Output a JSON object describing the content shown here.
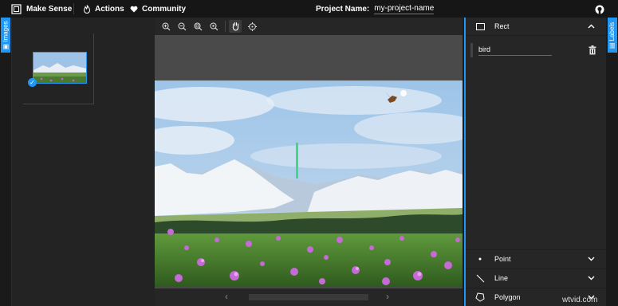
{
  "topbar": {
    "brand": "Make Sense",
    "actions": "Actions",
    "community": "Community",
    "project_label": "Project Name:",
    "project_value": "my-project-name"
  },
  "left_tab": {
    "label": "Images"
  },
  "right_tab": {
    "label": "Labels"
  },
  "thumbnails": [
    {
      "selected": true
    }
  ],
  "editor": {
    "tools": [
      "zoom-in",
      "zoom-out",
      "zoom-fit",
      "zoom-max",
      "pan",
      "crosshair"
    ],
    "active_tool": "pan"
  },
  "right_panel": {
    "rect": {
      "title": "Rect",
      "expanded": true,
      "labels": [
        {
          "value": "bird"
        }
      ]
    },
    "point": {
      "title": "Point"
    },
    "line": {
      "title": "Line"
    },
    "polygon": {
      "title": "Polygon"
    }
  },
  "watermark": "wtvid.com",
  "colors": {
    "accent": "#2196f3",
    "topbar": "#161616",
    "panel": "#262626",
    "box": "#3ddc84"
  }
}
